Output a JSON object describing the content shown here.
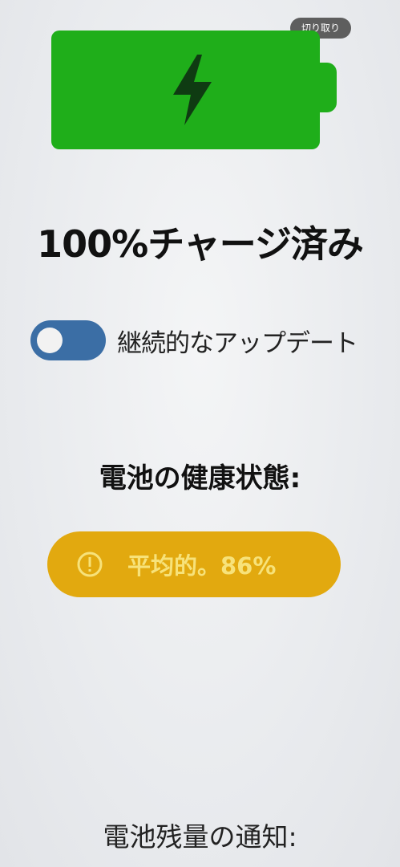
{
  "crop_badge": {
    "label": "切り取り"
  },
  "battery": {
    "icon": "lightning-bolt-icon",
    "fill_percent": 100,
    "color": "#1fae1a"
  },
  "charge_status": "100%チャージ済み",
  "continuous_updates": {
    "label": "継続的なアップデート",
    "enabled": false,
    "color": "#3b6ea5"
  },
  "battery_health": {
    "heading": "電池の健康状態:",
    "status_text": "平均的。86%",
    "icon": "alert-circle-icon",
    "color": "#e2a90f"
  },
  "battery_notification": {
    "heading": "電池残量の通知:"
  }
}
